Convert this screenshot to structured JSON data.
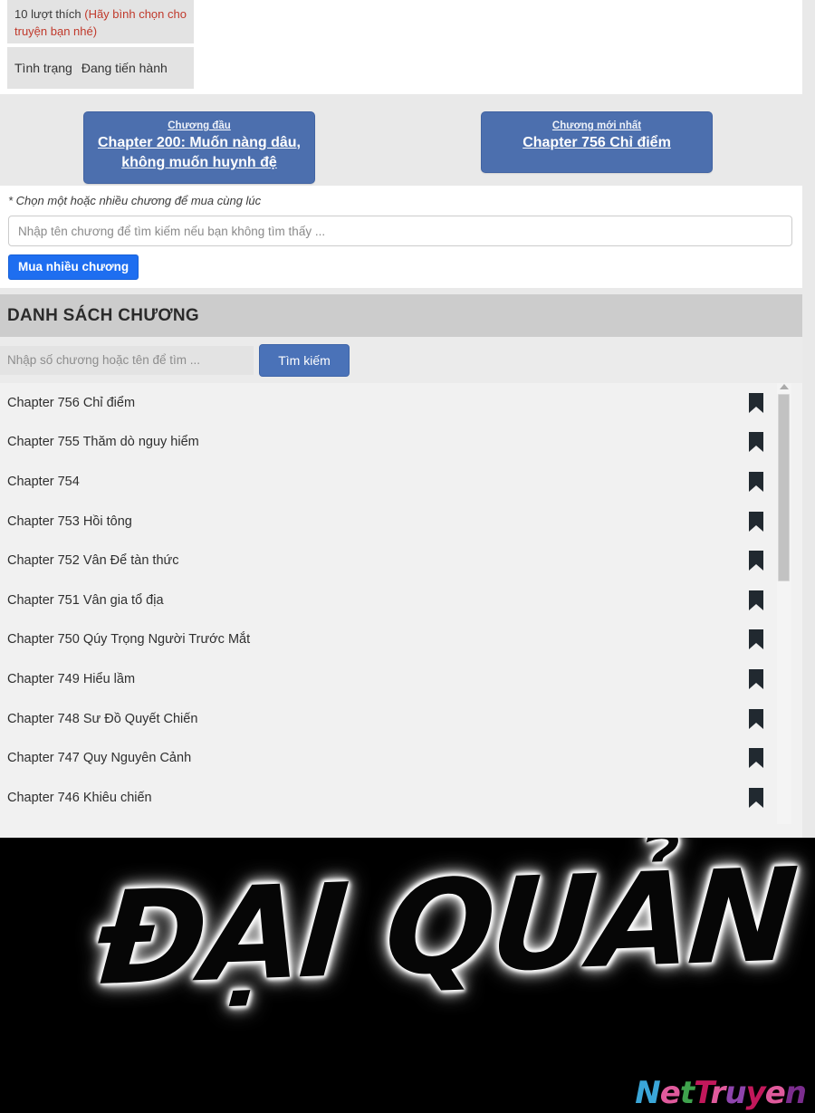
{
  "info": {
    "likes_count": "10 lượt thích",
    "likes_hint": "(Hãy bình chọn cho truyện bạn nhé)",
    "status_label": "Tình trạng",
    "status_value": "Đang tiến hành"
  },
  "nav": {
    "first": {
      "label": "Chương đầu",
      "chapter": "Chapter 200: Muốn nàng dâu, không muốn huynh đệ"
    },
    "latest": {
      "label": "Chương mới nhất",
      "chapter": "Chapter 756 Chỉ điểm"
    }
  },
  "buy": {
    "note": "* Chọn một hoặc nhiều chương để mua cùng lúc",
    "input_placeholder": "Nhập tên chương để tìm kiếm nếu bạn không tìm thấy ...",
    "input_value": "",
    "button_label": "Mua nhiều chương"
  },
  "chapter_list": {
    "title": "DANH SÁCH CHƯƠNG",
    "search_placeholder": "Nhập số chương hoặc tên để tìm ...",
    "search_value": "",
    "search_button": "Tìm kiếm",
    "bookmark_icon": "bookmark-icon",
    "items": [
      {
        "name": "Chapter 756 Chỉ điểm"
      },
      {
        "name": "Chapter 755 Thăm dò nguy hiểm"
      },
      {
        "name": "Chapter 754"
      },
      {
        "name": "Chapter 753 Hồi tông"
      },
      {
        "name": "Chapter 752 Vân Để tàn thức"
      },
      {
        "name": "Chapter 751 Vân gia tổ địa"
      },
      {
        "name": "Chapter 750 Qúy Trọng Người Trước Mắt"
      },
      {
        "name": "Chapter 749 Hiểu lầm"
      },
      {
        "name": "Chapter 748 Sư Đồ Quyết Chiến"
      },
      {
        "name": "Chapter 747 Quy Nguyên Cảnh"
      },
      {
        "name": "Chapter 746 Khiêu chiến"
      }
    ]
  },
  "manga_page": {
    "brush_text": "ĐẠI QUẢN G",
    "watermark": "NetTruyen",
    "background": "#000000"
  },
  "colors": {
    "nav_button": "#4c6fae",
    "buy_button": "#1e6ef0",
    "search_button": "#4a72b8",
    "list_header": "#cccccc",
    "hint_red": "#c0392b"
  }
}
